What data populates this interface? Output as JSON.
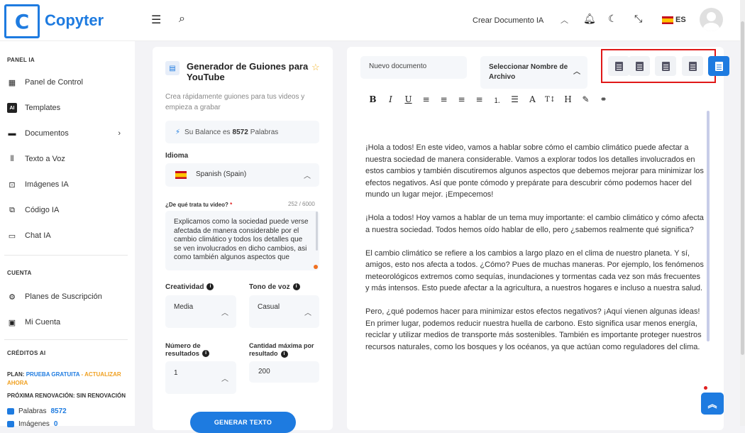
{
  "app": {
    "logo_letter": "C",
    "name": "Copyter"
  },
  "header": {
    "create_doc": "Crear Documento IA",
    "lang": "ES"
  },
  "sidebar": {
    "section_panel": "PANEL IA",
    "items": [
      {
        "label": "Panel de Control",
        "icon": "dashboard-icon"
      },
      {
        "label": "Templates",
        "icon": "ai-icon"
      },
      {
        "label": "Documentos",
        "icon": "folder-icon"
      },
      {
        "label": "Texto a Voz",
        "icon": "waveform-icon"
      },
      {
        "label": "Imágenes IA",
        "icon": "image-icon"
      },
      {
        "label": "Código IA",
        "icon": "code-icon"
      },
      {
        "label": "Chat IA",
        "icon": "chat-icon"
      }
    ],
    "section_account": "CUENTA",
    "account_items": [
      {
        "label": "Planes de Suscripción",
        "icon": "plans-icon"
      },
      {
        "label": "Mi Cuenta",
        "icon": "account-icon"
      }
    ],
    "section_credits": "CRÉDITOS AI",
    "plan_prefix": "PLAN:",
    "plan_name": "PRUEBA GRATUITA",
    "plan_upgrade": "- ACTUALIZAR AHORA",
    "renewal": "PRÓXIMA RENOVACIÓN: SIN RENOVACIÓN",
    "words_label": "Palabras",
    "words_value": "8572",
    "images_label": "Imágenes",
    "images_value": "0"
  },
  "generator": {
    "title": "Generador de Guiones para YouTube",
    "subtitle": "Crea rápidamente guiones para tus videos y empieza a grabar",
    "balance_prefix": "Su Balance es",
    "balance_value": "8572",
    "balance_suffix": "Palabras",
    "language_label": "Idioma",
    "language_value": "Spanish (Spain)",
    "topic_label": "¿De qué trata tu video?",
    "topic_required": "*",
    "topic_counter": "252 / 6000",
    "topic_value": "Explicamos como la sociedad puede verse afectada de manera considerable por el cambio climático y todos los detalles que se ven involucrados en dicho cambios, asi como también algunos aspectos que",
    "creativity_label": "Creatividad",
    "creativity_value": "Media",
    "tone_label": "Tono de voz",
    "tone_value": "Casual",
    "results_label": "Número de resultados",
    "results_value": "1",
    "max_label": "Cantidad máxima por resultado",
    "max_value": "200",
    "generate_button": "GENERAR TEXTO"
  },
  "editor": {
    "doc_name": "Nuevo documento",
    "select_name": "Seleccionar Nombre de Archivo",
    "toolbar": [
      "B",
      "I",
      "U",
      "≡",
      "≡",
      "≡",
      "≡",
      "⒈",
      "☰",
      "A",
      "T↕",
      "H",
      "✎",
      "⚭"
    ],
    "paragraphs": [
      "¡Hola a todos! En este video, vamos a hablar sobre cómo el cambio climático puede afectar a nuestra sociedad de manera considerable. Vamos a explorar todos los detalles involucrados en estos cambios y también discutiremos algunos aspectos que debemos mejorar para minimizar los efectos negativos. Así que ponte cómodo y prepárate para descubrir cómo podemos hacer del mundo un lugar mejor. ¡Empecemos!",
      "¡Hola a todos! Hoy vamos a hablar de un tema muy importante: el cambio climático y cómo afecta a nuestra sociedad. Todos hemos oído hablar de ello, pero ¿sabemos realmente qué significa?",
      "El cambio climático se refiere a los cambios a largo plazo en el clima de nuestro planeta. Y sí, amigos, esto nos afecta a todos. ¿Cómo? Pues de muchas maneras. Por ejemplo, los fenómenos meteorológicos extremos como sequías, inundaciones y tormentas cada vez son más frecuentes y más intensos. Esto puede afectar a la agricultura, a nuestros hogares e incluso a nuestra salud.",
      "Pero, ¿qué podemos hacer para minimizar estos efectos negativos? ¡Aquí vienen algunas ideas! En primer lugar, podemos reducir nuestra huella de carbono. Esto significa usar menos energía, reciclar y utilizar medios de transporte más sostenibles. También es importante proteger nuestros recursos naturales, como los bosques y los océanos, ya que actúan como reguladores del clima."
    ]
  },
  "colors": {
    "accent": "#1e7be0",
    "highlight": "#e01818",
    "upgrade": "#f0a020"
  }
}
